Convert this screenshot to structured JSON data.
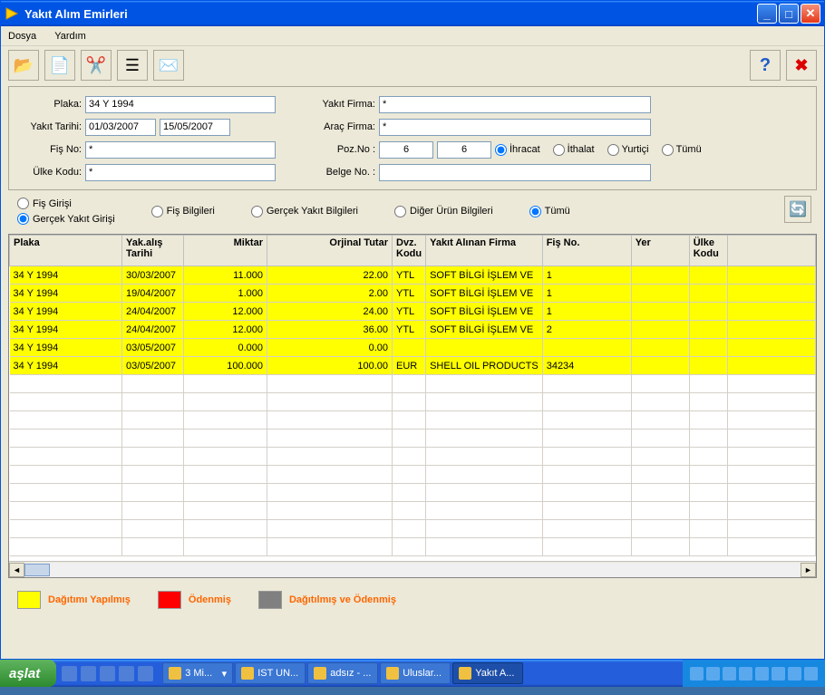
{
  "window": {
    "title": "Yakıt Alım Emirleri"
  },
  "menu": {
    "dosya": "Dosya",
    "yardim": "Yardım"
  },
  "form": {
    "labels": {
      "plaka": "Plaka:",
      "yakit_tarihi": "Yakıt Tarihi:",
      "fis_no": "Fiş No:",
      "ulke_kodu": "Ülke Kodu:",
      "yakit_firma": "Yakıt Firma:",
      "arac_firma": "Araç Firma:",
      "poz_no": "Poz.No :",
      "belge_no": "Belge No. :"
    },
    "values": {
      "plaka": "34 Y 1994",
      "tarih1": "01/03/2007",
      "tarih2": "15/05/2007",
      "fis_no": "*",
      "ulke_kodu": "*",
      "yakit_firma": "*",
      "arac_firma": "*",
      "poz1": "6",
      "poz2": "6",
      "belge_no": ""
    },
    "poz_opts": {
      "ihracat": "İhracat",
      "ithalat": "İthalat",
      "yurtici": "Yurtiçi",
      "tumu": "Tümü"
    }
  },
  "radios": {
    "left": {
      "fis_girisi": "Fiş Girişi",
      "gercek_yakit_girisi": "Gerçek Yakıt Girişi"
    },
    "center": {
      "fis_bilgileri": "Fiş Bilgileri",
      "gercek_yakit_bilgileri": "Gerçek Yakıt Bilgileri",
      "diger_urun": "Diğer Ürün Bilgileri",
      "tumu": "Tümü"
    }
  },
  "grid": {
    "headers": {
      "plaka": "Plaka",
      "yak_tarihi": "Yak.alış Tarihi",
      "miktar": "Miktar",
      "orjinal_tutar": "Orjinal Tutar",
      "dvz_kodu": "Dvz. Kodu",
      "yakit_firma": "Yakıt Alınan Firma",
      "fis_no": "Fiş No.",
      "yer": "Yer",
      "ulke_kodu": "Ülke Kodu"
    },
    "rows": [
      {
        "plaka": "34 Y 1994",
        "tarih": "30/03/2007",
        "miktar": "11.000",
        "tutar": "22.00",
        "dvz": "YTL",
        "firma": "SOFT BİLGİ İŞLEM VE",
        "fisno": "1",
        "yer": "",
        "ulke": ""
      },
      {
        "plaka": "34 Y 1994",
        "tarih": "19/04/2007",
        "miktar": "1.000",
        "tutar": "2.00",
        "dvz": "YTL",
        "firma": "SOFT BİLGİ İŞLEM VE",
        "fisno": "1",
        "yer": "",
        "ulke": ""
      },
      {
        "plaka": "34 Y 1994",
        "tarih": "24/04/2007",
        "miktar": "12.000",
        "tutar": "24.00",
        "dvz": "YTL",
        "firma": "SOFT BİLGİ İŞLEM VE",
        "fisno": "1",
        "yer": "",
        "ulke": ""
      },
      {
        "plaka": "34 Y 1994",
        "tarih": "24/04/2007",
        "miktar": "12.000",
        "tutar": "36.00",
        "dvz": "YTL",
        "firma": "SOFT BİLGİ İŞLEM VE",
        "fisno": "2",
        "yer": "",
        "ulke": ""
      },
      {
        "plaka": "34 Y 1994",
        "tarih": "03/05/2007",
        "miktar": "0.000",
        "tutar": "0.00",
        "dvz": "",
        "firma": "",
        "fisno": "",
        "yer": "",
        "ulke": ""
      },
      {
        "plaka": "34 Y 1994",
        "tarih": "03/05/2007",
        "miktar": "100.000",
        "tutar": "100.00",
        "dvz": "EUR",
        "firma": "SHELL OIL PRODUCTS",
        "fisno": "34234",
        "yer": "",
        "ulke": ""
      }
    ]
  },
  "legend": {
    "dagitimi_yapilmis": "Dağıtımı Yapılmış",
    "odenmis": "Ödenmiş",
    "dagitilmis_odenmis": "Dağıtılmış ve Ödenmiş"
  },
  "taskbar": {
    "start": "aşlat",
    "tasks": [
      {
        "label": "3 Mi...",
        "dd": "▾"
      },
      {
        "label": "IST UN..."
      },
      {
        "label": "adsız - ..."
      },
      {
        "label": "Uluslar..."
      },
      {
        "label": "Yakıt A...",
        "active": true
      }
    ]
  }
}
